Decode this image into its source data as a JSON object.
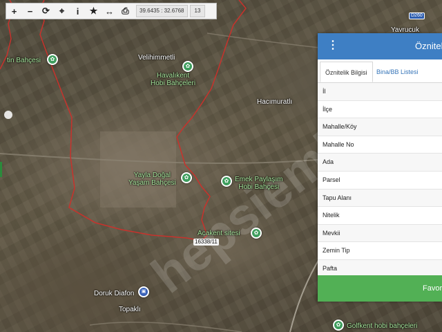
{
  "toolbar": {
    "buttons": [
      {
        "name": "zoom-in-icon",
        "glyph": "+"
      },
      {
        "name": "zoom-out-icon",
        "glyph": "−"
      },
      {
        "name": "refresh-icon",
        "glyph": "⟳"
      },
      {
        "name": "locate-icon",
        "glyph": "⌖"
      },
      {
        "name": "info-icon",
        "glyph": "i"
      },
      {
        "name": "favorite-star-icon",
        "glyph": "★"
      },
      {
        "name": "measure-icon",
        "glyph": "↔"
      },
      {
        "name": "print-icon",
        "glyph": "⎙"
      }
    ],
    "coordinates": "39.6435 : 32.6768",
    "zoom_level": "13"
  },
  "map": {
    "place_labels": {
      "yavrucuk": "Yavrucuk",
      "velihimmetli": "Velihimmetli",
      "hacimuratli": "Hacımuratlı",
      "topakli": "Topaklı",
      "bahcesi_left": "tin Bahçesi"
    },
    "poi_labels": {
      "havalikent": "Havalıkent\nHobi Bahçeleri",
      "yayla": "Yayla Doğal\nYaşam Bahçesi",
      "emek": "Emek Paylaşım\nHobi Bahçesi",
      "acakent": "Acakent sitesi",
      "doruk": "Doruk Diafon",
      "golfkent": "Golfkent hobi bahçeleri"
    },
    "parcel_label": "16338/11",
    "road_badge": "D260",
    "colors": {
      "boundary": "#c8322c",
      "poi_green": "#3f9e5e",
      "poi_blue": "#3a62b8"
    }
  },
  "panel": {
    "title": "Öznitelik",
    "tabs": [
      "Öznitelik Bilgisi",
      "Bina/BB Listesi"
    ],
    "fields": [
      "İl",
      "İlçe",
      "Mahalle/Köy",
      "Mahalle No",
      "Ada",
      "Parsel",
      "Tapu Alanı",
      "Nitelik",
      "Mevkii",
      "Zemin Tip",
      "Pafta"
    ],
    "favorite_label": "Favor",
    "header_color": "#3e7fc4",
    "button_color": "#52b055"
  }
}
